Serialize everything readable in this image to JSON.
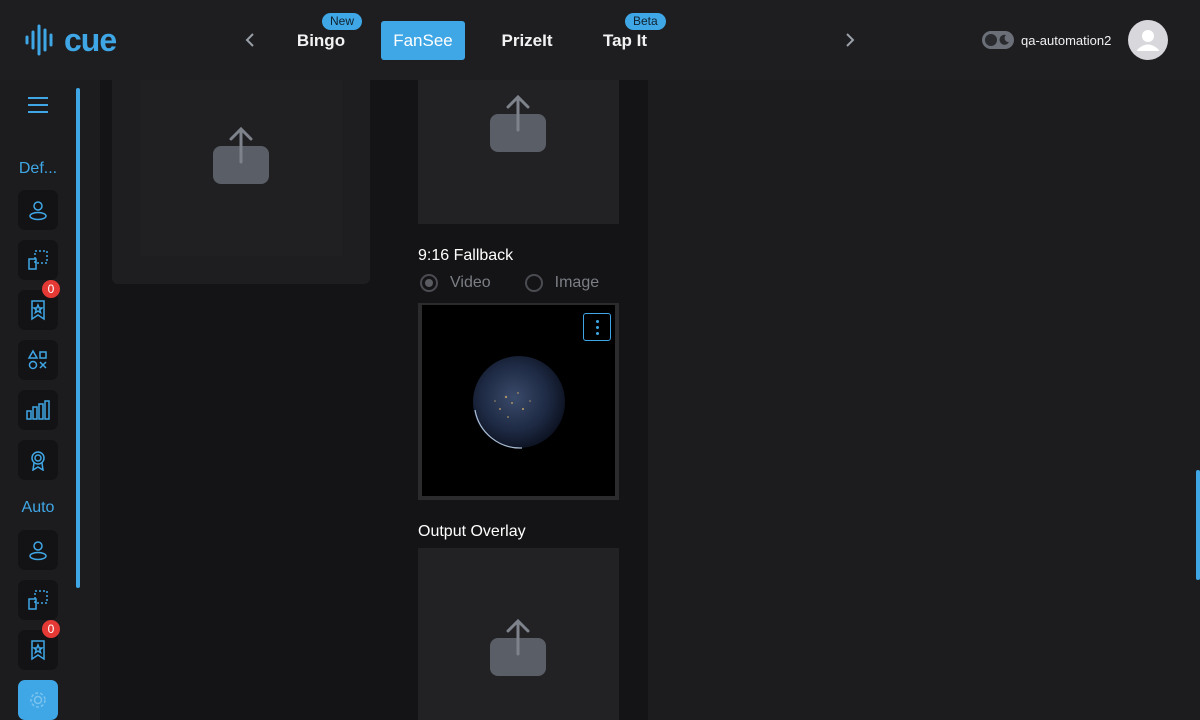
{
  "app": {
    "logo_text": "cue"
  },
  "topnav": {
    "tabs": [
      {
        "label": "Bingo",
        "badge": "New"
      },
      {
        "label": "FanSee",
        "badge": ""
      },
      {
        "label": "PrizeIt",
        "badge": ""
      },
      {
        "label": "Tap It",
        "badge": "Beta"
      }
    ],
    "active_tab": "FanSee"
  },
  "user": {
    "name": "qa-automation2"
  },
  "sidebar": {
    "group1_label": "Def...",
    "group2_label": "Auto",
    "badge_count_1": "0",
    "badge_count_2": "0"
  },
  "main": {
    "fallback_title": "9:16 Fallback",
    "media_type": {
      "video_label": "Video",
      "image_label": "Image",
      "selected": "Video"
    },
    "overlay_title": "Output Overlay"
  },
  "colors": {
    "accent": "#3fa7e6",
    "background": "#1c1c1f",
    "panel": "#141416",
    "badge_red": "#e53935"
  },
  "icons": [
    "menu-icon",
    "user-icon",
    "layout-icon",
    "bookmark-star-icon",
    "shapes-icon",
    "bar-chart-icon",
    "award-icon",
    "upload-icon",
    "more-vertical-icon",
    "theme-toggle-icon",
    "avatar-icon"
  ]
}
